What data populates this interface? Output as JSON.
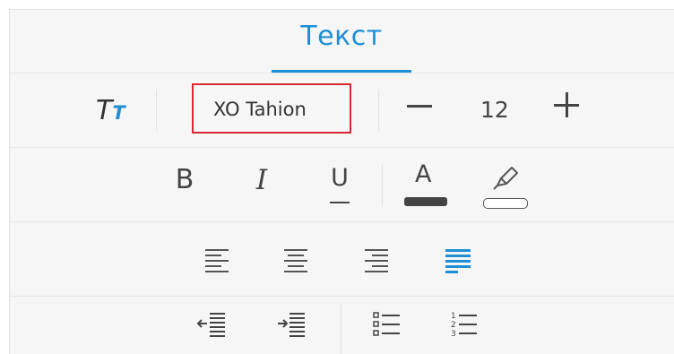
{
  "tab": {
    "label": "Текст",
    "active": true,
    "accent_color": "#1e8fd6"
  },
  "font_row": {
    "text_style_icon": "text-style-icon",
    "text_style_big": "T",
    "text_style_small": "T",
    "font_name": "XO Tahion",
    "font_size": "12",
    "decrease_icon": "minus-icon",
    "increase_icon": "plus-icon"
  },
  "format_row": {
    "bold_label": "B",
    "italic_label": "I",
    "underline_label": "U",
    "font_color_label": "A",
    "font_color_swatch": "#444444",
    "highlight_icon": "highlighter-icon",
    "highlight_swatch": "#ffffff"
  },
  "align_row": {
    "options": [
      "align-left",
      "align-center",
      "align-right",
      "align-justify"
    ],
    "selected": "align-justify"
  },
  "list_row": {
    "icons": [
      "indent-decrease-icon",
      "indent-increase-icon",
      "bulleted-list-icon",
      "numbered-list-icon"
    ],
    "number_markers": [
      "1",
      "2",
      "3"
    ]
  }
}
